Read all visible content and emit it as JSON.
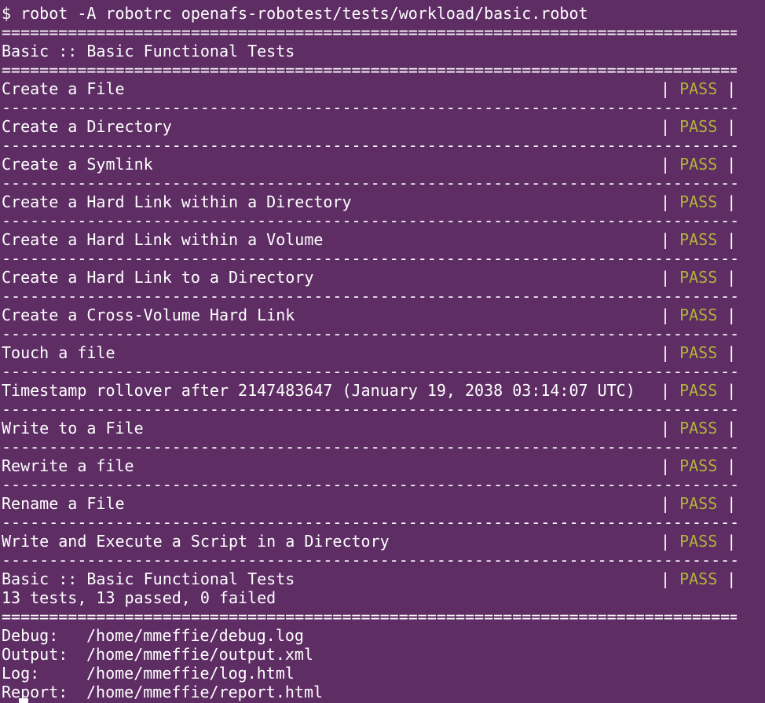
{
  "prompt": "$ robot -A robotrc openafs-robotest/tests/workload/basic.robot",
  "separators": {
    "double": "==============================================================================",
    "single": "------------------------------------------------------------------------------"
  },
  "suite_header": "Basic :: Basic Functional Tests",
  "tests": [
    {
      "name": "Create a File",
      "status": "PASS"
    },
    {
      "name": "Create a Directory",
      "status": "PASS"
    },
    {
      "name": "Create a Symlink",
      "status": "PASS"
    },
    {
      "name": "Create a Hard Link within a Directory",
      "status": "PASS"
    },
    {
      "name": "Create a Hard Link within a Volume",
      "status": "PASS"
    },
    {
      "name": "Create a Hard Link to a Directory",
      "status": "PASS"
    },
    {
      "name": "Create a Cross-Volume Hard Link",
      "status": "PASS"
    },
    {
      "name": "Touch a file",
      "status": "PASS"
    },
    {
      "name": "Timestamp rollover after 2147483647 (January 19, 2038 03:14:07 UTC)",
      "status": "PASS"
    },
    {
      "name": "Write to a File",
      "status": "PASS"
    },
    {
      "name": "Rewrite a file",
      "status": "PASS"
    },
    {
      "name": "Rename a File",
      "status": "PASS"
    },
    {
      "name": "Write and Execute a Script in a Directory",
      "status": "PASS"
    }
  ],
  "suite_result": {
    "name": "Basic :: Basic Functional Tests",
    "status": "PASS",
    "summary": "13 tests, 13 passed, 0 failed"
  },
  "outputs": {
    "debug_label": "Debug:",
    "debug_path": "/home/mmeffie/debug.log",
    "output_label": "Output:",
    "output_path": "/home/mmeffie/output.xml",
    "log_label": "Log:",
    "log_path": "/home/mmeffie/log.html",
    "report_label": "Report:",
    "report_path": "/home/mmeffie/report.html"
  },
  "colors": {
    "background": "#5e2d64",
    "text": "#ffffff",
    "pass": "#b1b13a"
  }
}
